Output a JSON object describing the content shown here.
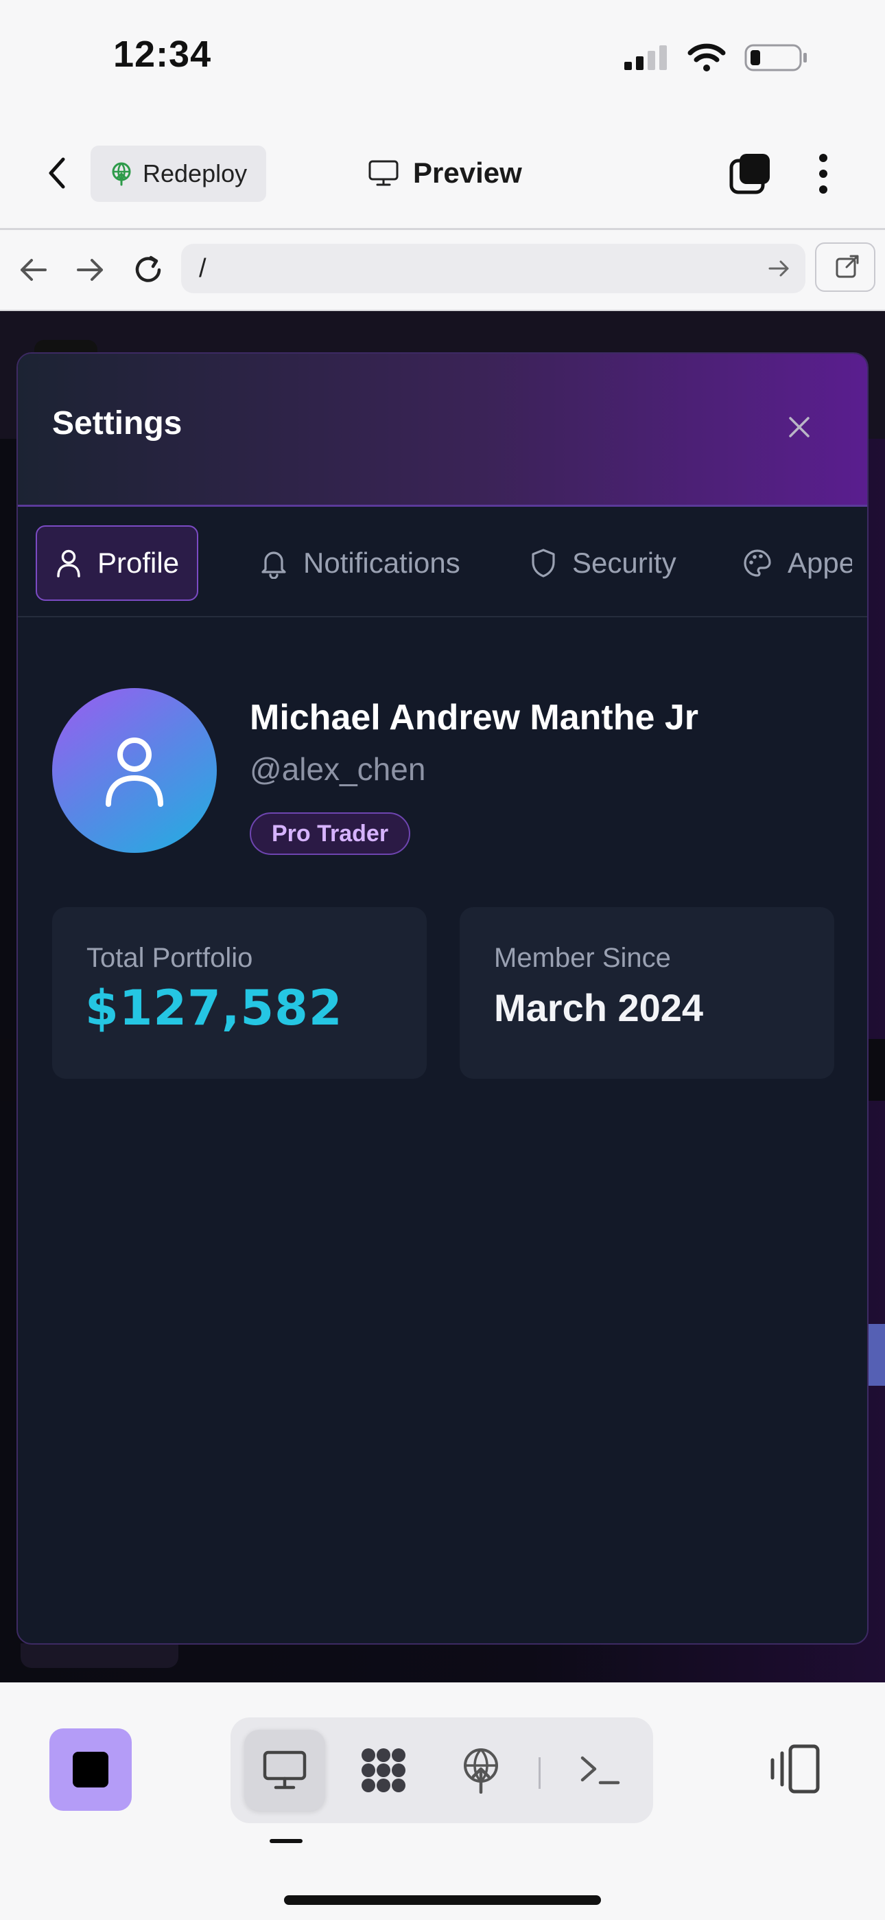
{
  "status_bar": {
    "time": "12:34"
  },
  "header": {
    "redeploy_label": "Redeploy",
    "preview_label": "Preview"
  },
  "url_bar": {
    "value": "/"
  },
  "modal": {
    "title": "Settings",
    "tabs": [
      {
        "label": "Profile",
        "icon": "user-icon",
        "active": true
      },
      {
        "label": "Notifications",
        "icon": "bell-icon",
        "active": false
      },
      {
        "label": "Security",
        "icon": "shield-icon",
        "active": false
      },
      {
        "label": "Appearance",
        "icon": "palette-icon",
        "active": false
      }
    ],
    "profile": {
      "name": "Michael Andrew Manthe Jr",
      "handle": "@alex_chen",
      "badge": "Pro Trader"
    },
    "stats": [
      {
        "label": "Total Portfolio",
        "value": "$127,582"
      },
      {
        "label": "Member Since",
        "value": "March 2024"
      }
    ]
  },
  "colors": {
    "accent_purple": "#7b4bc4",
    "portfolio_cyan": "#25c6e3",
    "stop_button": "#b49cf7"
  }
}
